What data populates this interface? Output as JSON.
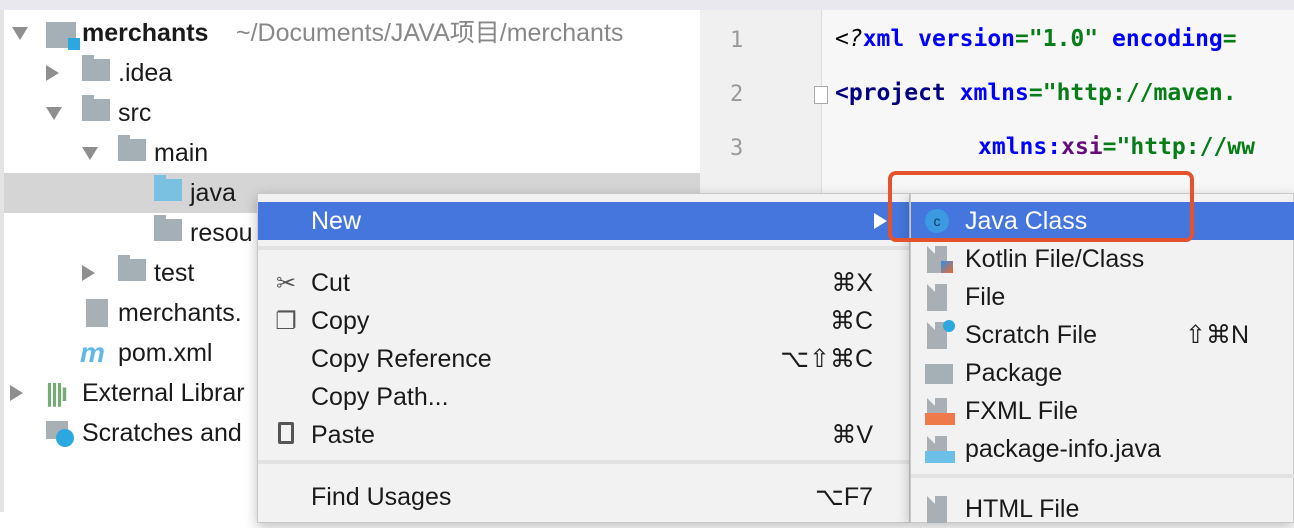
{
  "project_tree": {
    "root": {
      "name": "merchants",
      "path": "~/Documents/JAVA项目/merchants"
    },
    "items": [
      ".idea",
      "src",
      "main",
      "java",
      "resources",
      "test",
      "merchants.iml",
      "pom.xml",
      "External Libraries",
      "Scratches and Consoles"
    ],
    "visible_labels": [
      ".idea",
      "src",
      "main",
      "java",
      "resou",
      "test",
      "merchants.",
      "pom.xml",
      "External Librar",
      "Scratches and"
    ],
    "selected": "java"
  },
  "editor": {
    "line_numbers": [
      "1",
      "2",
      "3"
    ],
    "lines": [
      {
        "pi": "<?",
        "tag": "xml",
        "a1": " version",
        "eq1": "=",
        "v1": "\"1.0\"",
        "a2": " encoding",
        "eq2": "="
      },
      {
        "tag": "<project",
        "a1": " xmlns",
        "eq1": "=",
        "v1": "\"http://maven."
      },
      {
        "a1": "xmlns:",
        "ns": "xsi",
        "eq1": "=",
        "v1": "\"http://ww"
      }
    ]
  },
  "context_menu": {
    "items": [
      {
        "label": "New",
        "shortcut": "",
        "icon": "",
        "highlighted": true,
        "submenu": true
      },
      {
        "label": "Cut",
        "shortcut": "⌘X",
        "icon": "scissors-icon"
      },
      {
        "label": "Copy",
        "shortcut": "⌘C",
        "icon": "copy-icon"
      },
      {
        "label": "Copy Reference",
        "shortcut": "⌥⇧⌘C",
        "icon": ""
      },
      {
        "label": "Copy Path...",
        "shortcut": "",
        "icon": ""
      },
      {
        "label": "Paste",
        "shortcut": "⌘V",
        "icon": "clipboard-icon"
      },
      {
        "label": "Find Usages",
        "shortcut": "⌥F7",
        "icon": ""
      }
    ]
  },
  "new_submenu": {
    "items": [
      {
        "label": "Java Class",
        "shortcut": "",
        "icon": "java-class-icon",
        "highlighted": true
      },
      {
        "label": "Kotlin File/Class",
        "shortcut": "",
        "icon": "kotlin-file-icon"
      },
      {
        "label": "File",
        "shortcut": "",
        "icon": "file-icon"
      },
      {
        "label": "Scratch File",
        "shortcut": "⇧⌘N",
        "icon": "scratch-file-icon"
      },
      {
        "label": "Package",
        "shortcut": "",
        "icon": "package-icon"
      },
      {
        "label": "FXML File",
        "shortcut": "",
        "icon": "fxml-file-icon"
      },
      {
        "label": "package-info.java",
        "shortcut": "",
        "icon": "package-info-icon"
      },
      {
        "label": "HTML File",
        "shortcut": "",
        "icon": "html-file-icon"
      }
    ]
  },
  "colors": {
    "highlight": "#4476dd",
    "annotation_box": "#e5522e",
    "selected_row": "#d5d5d5"
  }
}
